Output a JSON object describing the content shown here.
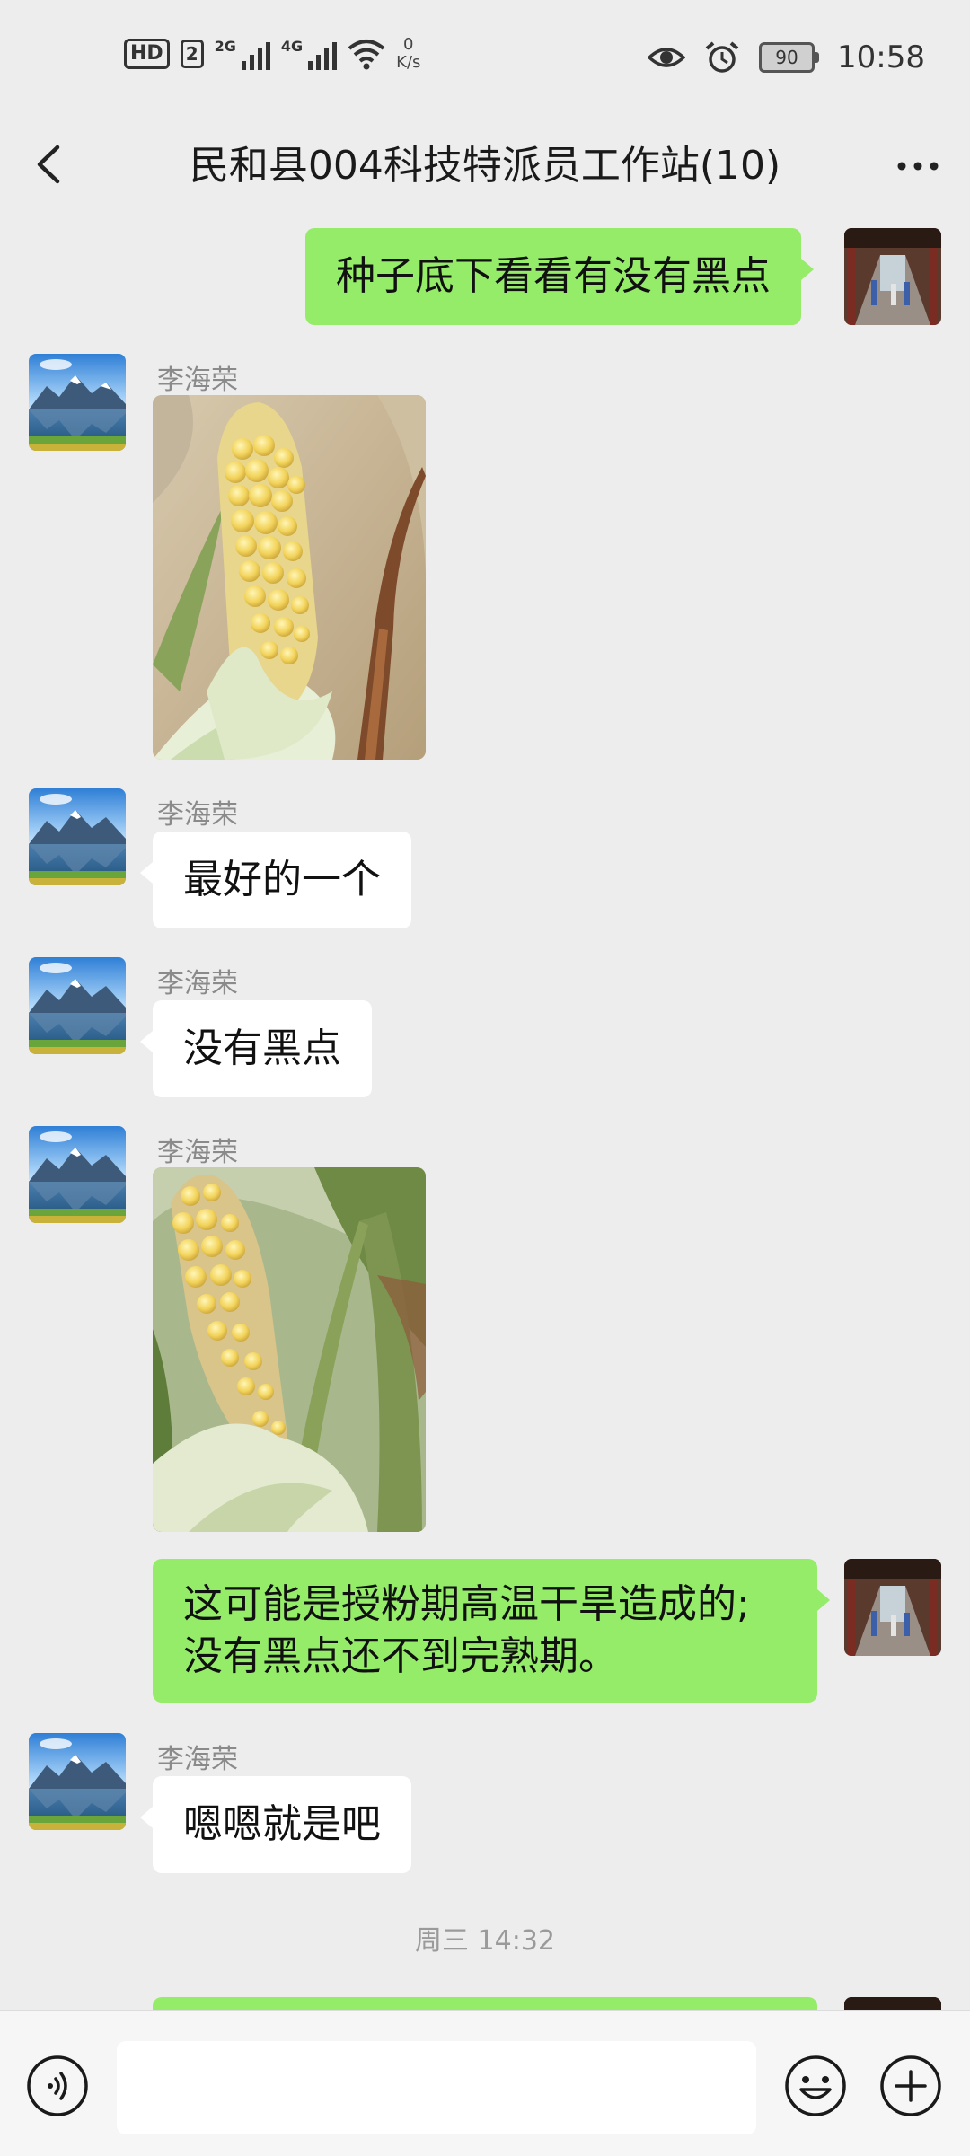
{
  "status_bar": {
    "hd": "HD",
    "sim": "2",
    "net1": "2G",
    "net2": "4G",
    "speed_value": "0",
    "speed_unit": "K/s",
    "battery": "90",
    "time": "10:58"
  },
  "header": {
    "title": "民和县004科技特派员工作站(10)"
  },
  "messages": [
    {
      "type": "text",
      "direction": "out",
      "text": "种子底下看看有没有黑点"
    },
    {
      "type": "image",
      "direction": "in",
      "sender": "李海荣"
    },
    {
      "type": "text",
      "direction": "in",
      "sender": "李海荣",
      "text": "最好的一个"
    },
    {
      "type": "text",
      "direction": "in",
      "sender": "李海荣",
      "text": "没有黑点"
    },
    {
      "type": "image",
      "direction": "in",
      "sender": "李海荣"
    },
    {
      "type": "text",
      "direction": "out",
      "lines": [
        "这可能是授粉期高温干旱造成的;",
        "没有黑点还不到完熟期。"
      ]
    },
    {
      "type": "text",
      "direction": "in",
      "sender": "李海荣",
      "text": "嗯嗯就是吧"
    }
  ],
  "timestamp": "周三 14:32",
  "input": {
    "value": "",
    "placeholder": ""
  },
  "icons": {
    "back": "chevron-left-icon",
    "more": "more-dots-icon",
    "voice": "voice-icon",
    "emoji": "emoji-icon",
    "plus": "plus-icon"
  },
  "colors": {
    "background": "#ededed",
    "out_bubble": "#95ec69",
    "in_bubble": "#ffffff",
    "meta_text": "#8a8a8a"
  }
}
